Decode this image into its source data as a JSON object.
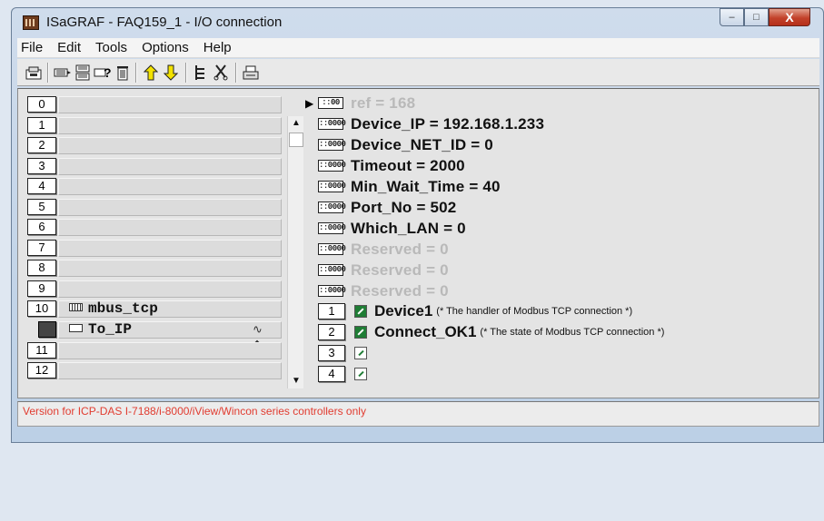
{
  "window": {
    "title": "ISaGRAF - FAQ159_1 - I/O connection",
    "buttons": {
      "minimize": "–",
      "maximize": "□",
      "close": "X"
    }
  },
  "menu": [
    "File",
    "Edit",
    "Tools",
    "Options",
    "Help"
  ],
  "toolbar": [
    "open-board-icon",
    "connect-icon",
    "board-list-icon",
    "board-help-icon",
    "delete-icon",
    "move-up-icon",
    "move-down-icon",
    "tree-icon",
    "cut-icon",
    "print-icon"
  ],
  "slots": [
    {
      "num": "0",
      "text": ""
    },
    {
      "num": "1",
      "text": ""
    },
    {
      "num": "2",
      "text": ""
    },
    {
      "num": "3",
      "text": ""
    },
    {
      "num": "4",
      "text": ""
    },
    {
      "num": "5",
      "text": ""
    },
    {
      "num": "6",
      "text": ""
    },
    {
      "num": "7",
      "text": ""
    },
    {
      "num": "8",
      "text": ""
    },
    {
      "num": "9",
      "text": ""
    },
    {
      "num": "10",
      "text": "mbus_tcp"
    },
    {
      "num": "",
      "text": "To_IP"
    },
    {
      "num": "11",
      "text": ""
    },
    {
      "num": "12",
      "text": ""
    }
  ],
  "params": [
    {
      "icon": "::00",
      "text": "ref = 168",
      "dim": true
    },
    {
      "icon": "::0000",
      "text": "Device_IP = 192.168.1.233",
      "dim": false
    },
    {
      "icon": "::0000",
      "text": "Device_NET_ID = 0",
      "dim": false
    },
    {
      "icon": "::0000",
      "text": "Timeout = 2000",
      "dim": false
    },
    {
      "icon": "::0000",
      "text": "Min_Wait_Time = 40",
      "dim": false
    },
    {
      "icon": "::0000",
      "text": "Port_No = 502",
      "dim": false
    },
    {
      "icon": "::0000",
      "text": "Which_LAN = 0",
      "dim": false
    },
    {
      "icon": "::0000",
      "text": "Reserved = 0",
      "dim": true
    },
    {
      "icon": "::0000",
      "text": "Reserved = 0",
      "dim": true
    },
    {
      "icon": "::0000",
      "text": "Reserved = 0",
      "dim": true
    }
  ],
  "channels": [
    {
      "num": "1",
      "name": "Device1",
      "comment": "(* The handler of Modbus TCP connection *)",
      "type": "bool"
    },
    {
      "num": "2",
      "name": "Connect_OK1",
      "comment": "(* The state of Modbus TCP connection *)",
      "type": "bool"
    },
    {
      "num": "3",
      "name": "",
      "comment": "",
      "type": "empty"
    },
    {
      "num": "4",
      "name": "",
      "comment": "",
      "type": "empty"
    }
  ],
  "status": "Version for ICP-DAS I-7188/i-8000/iView/Wincon series controllers only",
  "colors": {
    "status_text": "#e13c30",
    "bool_icon": "#1f7d35"
  }
}
